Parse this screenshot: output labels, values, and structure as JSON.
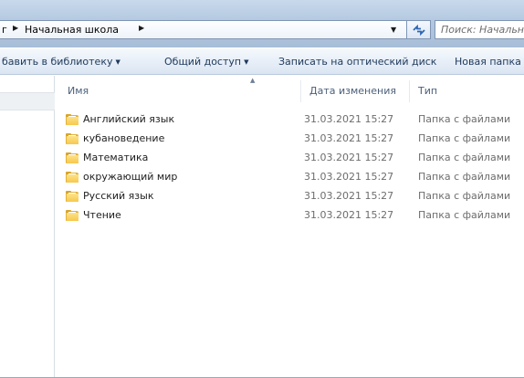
{
  "address_bar": {
    "crumbs": [
      "г",
      "Начальная школа"
    ],
    "refresh_icon": "refresh-icon"
  },
  "search": {
    "placeholder": "Поиск: Начальн"
  },
  "command_bar": {
    "add_to_library": "бавить в библиотеку",
    "share": "Общий доступ",
    "burn": "Записать на оптический диск",
    "new_folder": "Новая папка"
  },
  "columns": {
    "name": "Имя",
    "date": "Дата изменения",
    "type": "Тип"
  },
  "files": [
    {
      "name": "Английский язык",
      "date": "31.03.2021 15:27",
      "type": "Папка с файлами",
      "icon": "folder-icon"
    },
    {
      "name": "кубановедение",
      "date": "31.03.2021 15:27",
      "type": "Папка с файлами",
      "icon": "folder-icon"
    },
    {
      "name": "Математика",
      "date": "31.03.2021 15:27",
      "type": "Папка с файлами",
      "icon": "folder-icon"
    },
    {
      "name": "окружающий мир",
      "date": "31.03.2021 15:27",
      "type": "Папка с файлами",
      "icon": "folder-icon"
    },
    {
      "name": "Русский язык",
      "date": "31.03.2021 15:27",
      "type": "Папка с файлами",
      "icon": "folder-icon"
    },
    {
      "name": "Чтение",
      "date": "31.03.2021 15:27",
      "type": "Папка с файлами",
      "icon": "folder-icon"
    }
  ],
  "colors": {
    "folder": "#f7c84b",
    "command_text": "#1e395b"
  }
}
